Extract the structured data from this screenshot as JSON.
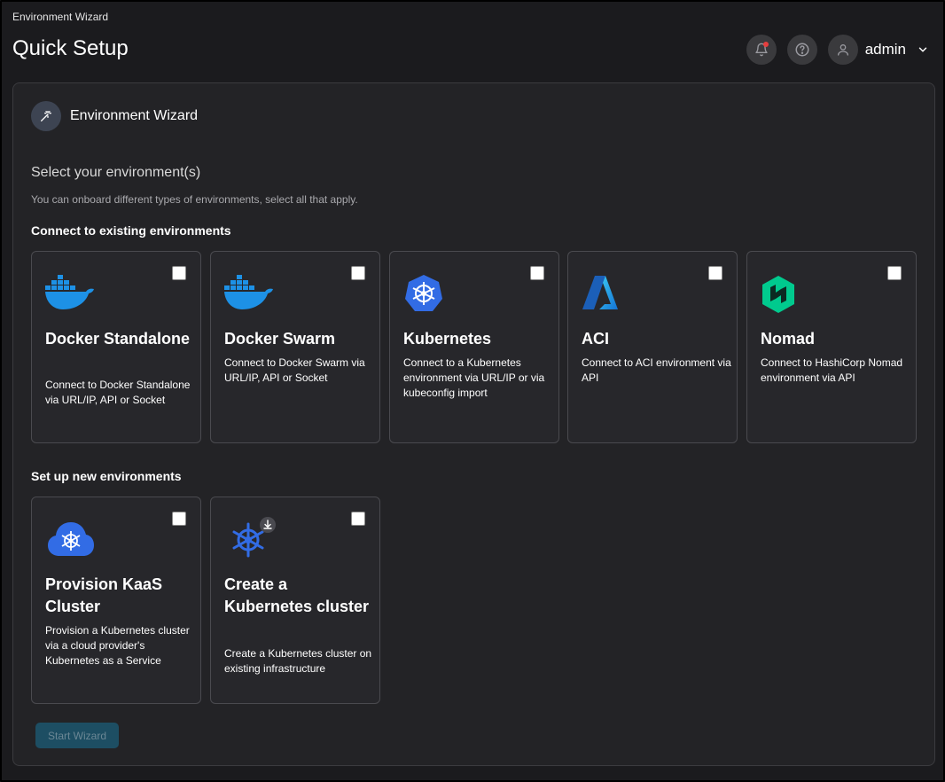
{
  "breadcrumb": "Environment Wizard",
  "page_title": "Quick Setup",
  "header": {
    "user_name": "admin",
    "icons": [
      "bell-icon",
      "help-icon",
      "user-icon",
      "chevron-down-icon"
    ]
  },
  "panel": {
    "title": "Environment Wizard",
    "section_title": "Select your environment(s)",
    "section_desc": "You can onboard different types of environments, select all that apply.",
    "group_existing": "Connect to existing environments",
    "group_new": "Set up new environments",
    "start_button": "Start Wizard"
  },
  "cards_existing": [
    {
      "title": "Docker Standalone",
      "desc": "Connect to Docker Standalone via URL/IP, API or Socket",
      "icon": "docker-icon",
      "checked": false
    },
    {
      "title": "Docker Swarm",
      "desc": "Connect to Docker Swarm via URL/IP, API or Socket",
      "icon": "docker-icon",
      "checked": false
    },
    {
      "title": "Kubernetes",
      "desc": "Connect to a Kubernetes environment via URL/IP or via kubeconfig import",
      "icon": "kubernetes-icon",
      "checked": false
    },
    {
      "title": "ACI",
      "desc": "Connect to ACI environment via API",
      "icon": "azure-icon",
      "checked": false
    },
    {
      "title": "Nomad",
      "desc": "Connect to HashiCorp Nomad environment via API",
      "icon": "nomad-icon",
      "checked": false
    }
  ],
  "cards_new": [
    {
      "title": "Provision KaaS Cluster",
      "desc": "Provision a Kubernetes cluster via a cloud provider's Kubernetes as a Service",
      "icon": "kaas-cloud-icon",
      "checked": false
    },
    {
      "title": "Create a Kubernetes cluster",
      "desc": "Create a Kubernetes cluster on existing infrastructure",
      "icon": "kubernetes-install-icon",
      "checked": false
    }
  ],
  "colors": {
    "background": "#1b1b1e",
    "panel": "#232326",
    "card": "#27272b",
    "docker_blue": "#1d91e6",
    "kubernetes_blue": "#326ce5",
    "nomad_green": "#00ca8e",
    "button_disabled": "#1d4e63",
    "notification": "#e53e3e"
  }
}
